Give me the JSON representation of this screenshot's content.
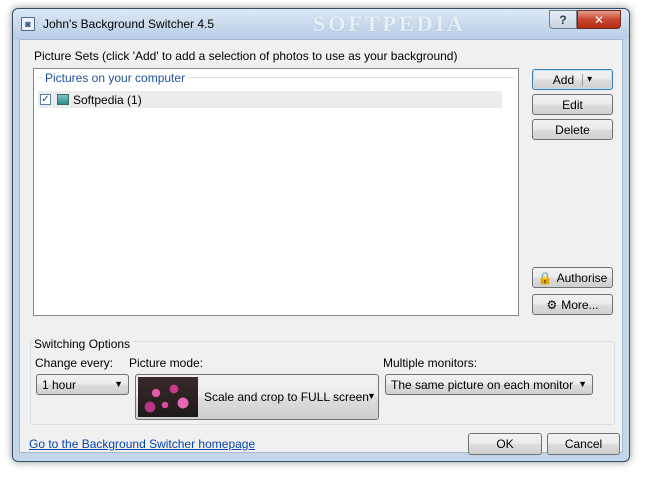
{
  "window": {
    "title": "John's Background Switcher 4.5",
    "watermark": "SOFTPEDIA",
    "help_label": "?",
    "close_label": "✕",
    "app_icon_glyph": "◙"
  },
  "picture_sets": {
    "heading": "Picture Sets (click 'Add' to add a selection of photos to use as your background)",
    "group_title": "Pictures on your computer",
    "items": [
      {
        "label": "Softpedia (1)",
        "checked": true,
        "check_glyph": "✓"
      }
    ]
  },
  "buttons": {
    "add": "Add",
    "add_arrow": "▾",
    "edit": "Edit",
    "delete": "Delete",
    "authorise": "Authorise",
    "authorise_icon": "🔒",
    "more": "More...",
    "more_icon": "⚙",
    "ok": "OK",
    "cancel": "Cancel"
  },
  "switching": {
    "heading": "Switching Options",
    "change_every_label": "Change every:",
    "change_every_value": "1 hour",
    "picture_mode_label": "Picture mode:",
    "picture_mode_value": "Scale and crop to FULL screen",
    "multiple_monitors_label": "Multiple monitors:",
    "multiple_monitors_value": "The same picture on each monitor",
    "combo_arrow": "▼"
  },
  "footer": {
    "homepage_link": "Go to the Background Switcher homepage"
  },
  "colors": {
    "group_title": "#1e4f9a",
    "link": "#0645ad",
    "close_button": "#c8452d"
  }
}
